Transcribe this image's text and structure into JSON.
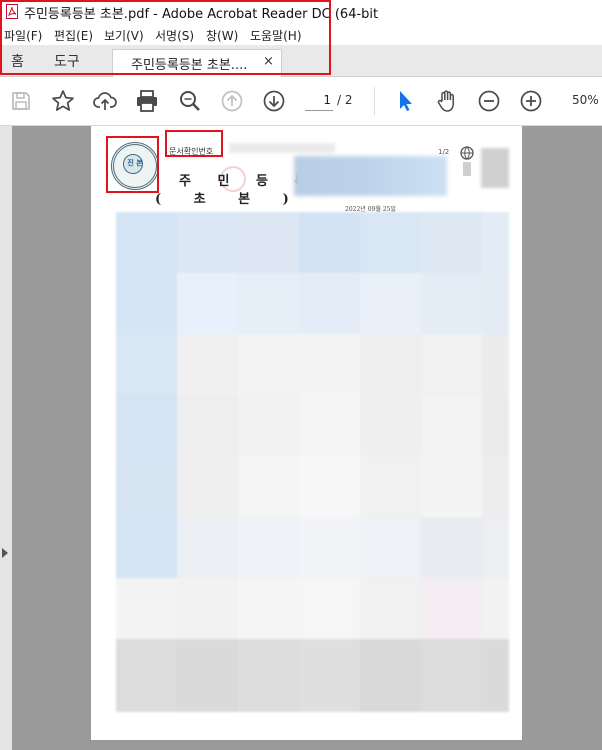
{
  "window": {
    "title": "주민등록등본 초본.pdf - Adobe Acrobat Reader DC (64-bit"
  },
  "menubar": {
    "items": [
      "파일(F)",
      "편집(E)",
      "보기(V)",
      "서명(S)",
      "창(W)",
      "도움말(H)"
    ]
  },
  "tabs": {
    "home": "홈",
    "tools": "도구",
    "document": "주민등록등본 초본....",
    "close": "×"
  },
  "toolbar": {
    "icons": [
      "save-icon",
      "bookmark-star-icon",
      "upload-cloud-icon",
      "print-icon",
      "zoom-search-icon",
      "previous-page-icon",
      "next-page-icon",
      "select-pointer-icon",
      "hand-tool-icon",
      "zoom-out-icon",
      "zoom-in-icon"
    ],
    "current_page": "1",
    "total_pages": "/  2",
    "zoom": "50%",
    "accent_color": "#1473e6"
  },
  "document_page": {
    "seal_text": "진 본",
    "doc_id_label": "문서확인번호",
    "page_count": "1/2",
    "title": "주 민 등 록 표",
    "subtitle": "( 초 본 )",
    "issue_date": "2022년 09월 25일"
  },
  "highlight_color": "#e0141c"
}
